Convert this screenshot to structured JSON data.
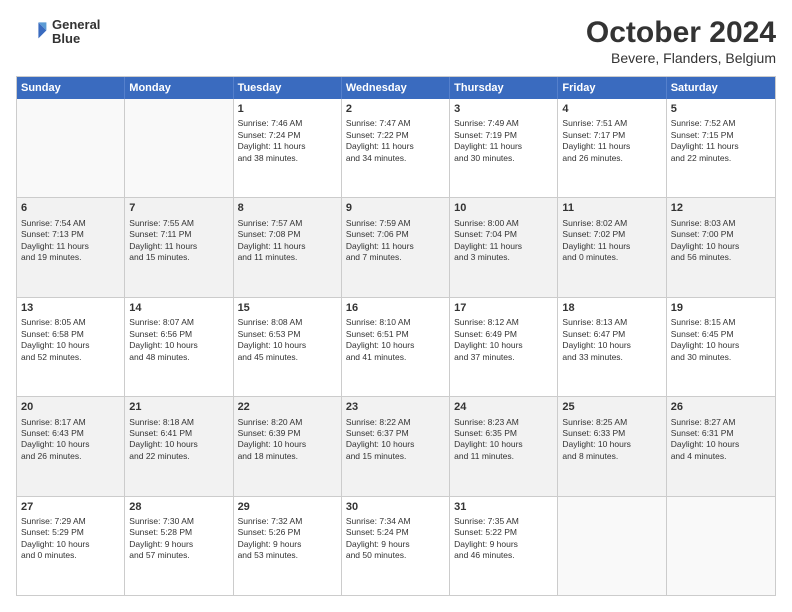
{
  "logo": {
    "line1": "General",
    "line2": "Blue"
  },
  "title": "October 2024",
  "subtitle": "Bevere, Flanders, Belgium",
  "days": [
    "Sunday",
    "Monday",
    "Tuesday",
    "Wednesday",
    "Thursday",
    "Friday",
    "Saturday"
  ],
  "weeks": [
    [
      {
        "day": "",
        "info": ""
      },
      {
        "day": "",
        "info": ""
      },
      {
        "day": "1",
        "info": "Sunrise: 7:46 AM\nSunset: 7:24 PM\nDaylight: 11 hours\nand 38 minutes."
      },
      {
        "day": "2",
        "info": "Sunrise: 7:47 AM\nSunset: 7:22 PM\nDaylight: 11 hours\nand 34 minutes."
      },
      {
        "day": "3",
        "info": "Sunrise: 7:49 AM\nSunset: 7:19 PM\nDaylight: 11 hours\nand 30 minutes."
      },
      {
        "day": "4",
        "info": "Sunrise: 7:51 AM\nSunset: 7:17 PM\nDaylight: 11 hours\nand 26 minutes."
      },
      {
        "day": "5",
        "info": "Sunrise: 7:52 AM\nSunset: 7:15 PM\nDaylight: 11 hours\nand 22 minutes."
      }
    ],
    [
      {
        "day": "6",
        "info": "Sunrise: 7:54 AM\nSunset: 7:13 PM\nDaylight: 11 hours\nand 19 minutes."
      },
      {
        "day": "7",
        "info": "Sunrise: 7:55 AM\nSunset: 7:11 PM\nDaylight: 11 hours\nand 15 minutes."
      },
      {
        "day": "8",
        "info": "Sunrise: 7:57 AM\nSunset: 7:08 PM\nDaylight: 11 hours\nand 11 minutes."
      },
      {
        "day": "9",
        "info": "Sunrise: 7:59 AM\nSunset: 7:06 PM\nDaylight: 11 hours\nand 7 minutes."
      },
      {
        "day": "10",
        "info": "Sunrise: 8:00 AM\nSunset: 7:04 PM\nDaylight: 11 hours\nand 3 minutes."
      },
      {
        "day": "11",
        "info": "Sunrise: 8:02 AM\nSunset: 7:02 PM\nDaylight: 11 hours\nand 0 minutes."
      },
      {
        "day": "12",
        "info": "Sunrise: 8:03 AM\nSunset: 7:00 PM\nDaylight: 10 hours\nand 56 minutes."
      }
    ],
    [
      {
        "day": "13",
        "info": "Sunrise: 8:05 AM\nSunset: 6:58 PM\nDaylight: 10 hours\nand 52 minutes."
      },
      {
        "day": "14",
        "info": "Sunrise: 8:07 AM\nSunset: 6:56 PM\nDaylight: 10 hours\nand 48 minutes."
      },
      {
        "day": "15",
        "info": "Sunrise: 8:08 AM\nSunset: 6:53 PM\nDaylight: 10 hours\nand 45 minutes."
      },
      {
        "day": "16",
        "info": "Sunrise: 8:10 AM\nSunset: 6:51 PM\nDaylight: 10 hours\nand 41 minutes."
      },
      {
        "day": "17",
        "info": "Sunrise: 8:12 AM\nSunset: 6:49 PM\nDaylight: 10 hours\nand 37 minutes."
      },
      {
        "day": "18",
        "info": "Sunrise: 8:13 AM\nSunset: 6:47 PM\nDaylight: 10 hours\nand 33 minutes."
      },
      {
        "day": "19",
        "info": "Sunrise: 8:15 AM\nSunset: 6:45 PM\nDaylight: 10 hours\nand 30 minutes."
      }
    ],
    [
      {
        "day": "20",
        "info": "Sunrise: 8:17 AM\nSunset: 6:43 PM\nDaylight: 10 hours\nand 26 minutes."
      },
      {
        "day": "21",
        "info": "Sunrise: 8:18 AM\nSunset: 6:41 PM\nDaylight: 10 hours\nand 22 minutes."
      },
      {
        "day": "22",
        "info": "Sunrise: 8:20 AM\nSunset: 6:39 PM\nDaylight: 10 hours\nand 18 minutes."
      },
      {
        "day": "23",
        "info": "Sunrise: 8:22 AM\nSunset: 6:37 PM\nDaylight: 10 hours\nand 15 minutes."
      },
      {
        "day": "24",
        "info": "Sunrise: 8:23 AM\nSunset: 6:35 PM\nDaylight: 10 hours\nand 11 minutes."
      },
      {
        "day": "25",
        "info": "Sunrise: 8:25 AM\nSunset: 6:33 PM\nDaylight: 10 hours\nand 8 minutes."
      },
      {
        "day": "26",
        "info": "Sunrise: 8:27 AM\nSunset: 6:31 PM\nDaylight: 10 hours\nand 4 minutes."
      }
    ],
    [
      {
        "day": "27",
        "info": "Sunrise: 7:29 AM\nSunset: 5:29 PM\nDaylight: 10 hours\nand 0 minutes."
      },
      {
        "day": "28",
        "info": "Sunrise: 7:30 AM\nSunset: 5:28 PM\nDaylight: 9 hours\nand 57 minutes."
      },
      {
        "day": "29",
        "info": "Sunrise: 7:32 AM\nSunset: 5:26 PM\nDaylight: 9 hours\nand 53 minutes."
      },
      {
        "day": "30",
        "info": "Sunrise: 7:34 AM\nSunset: 5:24 PM\nDaylight: 9 hours\nand 50 minutes."
      },
      {
        "day": "31",
        "info": "Sunrise: 7:35 AM\nSunset: 5:22 PM\nDaylight: 9 hours\nand 46 minutes."
      },
      {
        "day": "",
        "info": ""
      },
      {
        "day": "",
        "info": ""
      }
    ]
  ]
}
